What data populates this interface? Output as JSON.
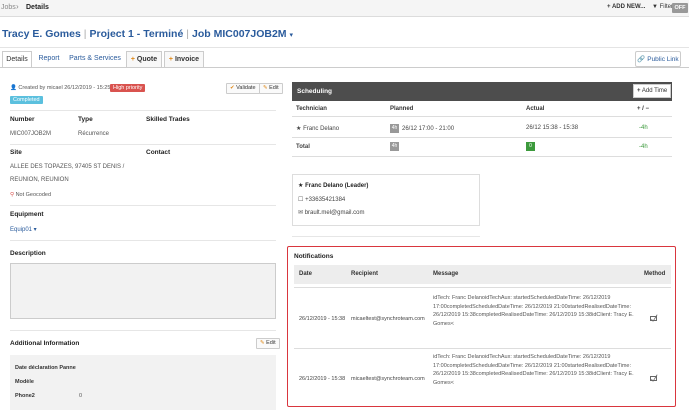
{
  "breadcrumb": {
    "jobs": "Jobs",
    "separator": "›",
    "current": "Details"
  },
  "topbar": {
    "add_new": "+ ADD NEW...",
    "filter": "Filter",
    "filter_state": "OFF"
  },
  "title": {
    "client": "Tracy E. Gomes",
    "project": "Project 1 - Terminé",
    "job": "Job MIC007JOB2M",
    "caret": "▾"
  },
  "tabs": [
    {
      "label": "Details"
    },
    {
      "label": "Report"
    },
    {
      "label": "Parts & Services"
    },
    {
      "label": "Quote"
    },
    {
      "label": "Invoice"
    }
  ],
  "public_link": "Public Link",
  "job": {
    "created": "Created by micael   26/12/2019 - 15:25",
    "priority": "High priority",
    "status": "Completed",
    "validate_label": "Validate",
    "edit_label": "Edit",
    "number_label": "Number",
    "number_value": "MIC007JOB2M",
    "type_label": "Type",
    "type_value": "Récurrence",
    "skilled_label": "Skilled Trades",
    "site_label": "Site",
    "site_line1": "ALLEE DES TOPAZES, 97405 ST DENIS /",
    "site_line2": "REUNION, REUNION",
    "geocode": "Not Geocoded",
    "contact_label": "Contact",
    "equipment_label": "Equipment",
    "equipment_value": "Equip01 ▾",
    "description_label": "Description",
    "additional_label": "Additional Information",
    "additional_edit": "Edit",
    "fields": [
      {
        "label": "Date déclaration Panne",
        "value": ""
      },
      {
        "label": "Modèle",
        "value": ""
      },
      {
        "label": "Phone2",
        "value": "0"
      }
    ]
  },
  "scheduling": {
    "title": "Scheduling",
    "add_time": "Add Time",
    "headers": {
      "technician": "Technician",
      "planned": "Planned",
      "actual": "Actual",
      "diff": "+ / −"
    },
    "row": {
      "technician": "Franc Delano",
      "planned_chip": "4h",
      "planned": "26/12 17:00 - 21:00",
      "actual": "26/12 15:38 - 15:38",
      "diff": "-4h"
    },
    "total": {
      "label": "Total",
      "planned_chip": "4h",
      "actual_chip": "0",
      "diff": "-4h"
    }
  },
  "technician_card": {
    "name": "Franc Delano (Leader)",
    "phone": "+33635421384",
    "email": "brault.mel@gmail.com"
  },
  "notifications": {
    "title": "Notifications",
    "headers": {
      "date": "Date",
      "recipient": "Recipient",
      "message": "Message",
      "method": "Method"
    },
    "rows": [
      {
        "date": "26/12/2019 - 15:38",
        "recipient": "micaeltest@synchroteam.com",
        "message": "idTech: Franc DelanoidTechAux: startedScheduledDateTime: 26/12/2019 17:00completedScheduledDateTime: 26/12/2019 21:00startedRealisedDateTime: 26/12/2019 15:38completedRealisedDateTime: 26/12/2019 15:38idClient: Tracy E. Gomes<"
      },
      {
        "date": "26/12/2019 - 15:38",
        "recipient": "micaeltest@synchroteam.com",
        "message": "idTech: Franc DelanoidTechAux: startedScheduledDateTime: 26/12/2019 17:00completedScheduledDateTime: 26/12/2019 21:00startedRealisedDateTime: 26/12/2019 15:38completedRealisedDateTime: 26/12/2019 15:38idClient: Tracy E. Gomes<"
      }
    ]
  }
}
